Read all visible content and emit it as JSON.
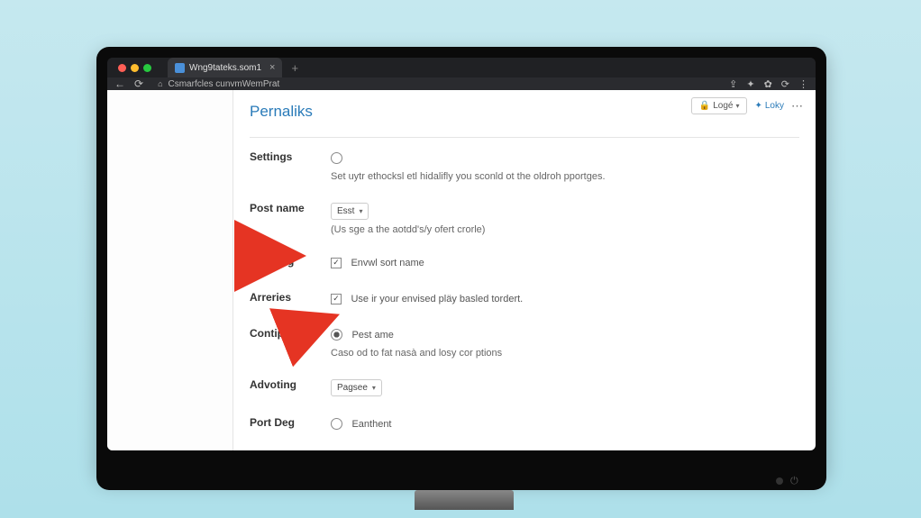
{
  "browser": {
    "tab_title": "Wng9tateks.som1",
    "url": "Csmarfcles cunvmWemPrat"
  },
  "top_actions": {
    "button_label": "Logé",
    "link_label": "Loky"
  },
  "page": {
    "title": "Pernaliks"
  },
  "settings": {
    "label": "Settings",
    "help": "Set uytr ethocksl etl hidalifly you sconld ot the oldroh pportges."
  },
  "post_name": {
    "label": "Post name",
    "select_value": "Esst",
    "help": "(Us sge a the aotdd's/y ofert crorle)"
  },
  "durdling": {
    "label": "Durdling",
    "option": "Envwl sort name"
  },
  "arreries": {
    "label": "Arreries",
    "option": "Use ir your envised pläy basled tordert."
  },
  "contiplus": {
    "label": "Contiplus",
    "option": "Pest ame",
    "help": "Caso od to fat nasà and losy cor ptions"
  },
  "advoting": {
    "label": "Advoting",
    "select_value": "Pagsee"
  },
  "pard": {
    "label": "Port Deg",
    "option": "Eanthent"
  }
}
